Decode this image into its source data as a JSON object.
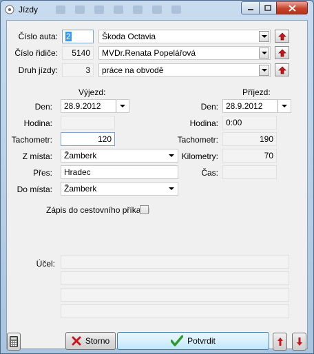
{
  "window": {
    "title": "Jízdy",
    "icon": "app-icon",
    "controls": {
      "minimize": "minimize-icon",
      "maximize": "maximize-icon",
      "close": "close-icon"
    }
  },
  "header": {
    "car_label": "Číslo auta:",
    "car_number": "2",
    "car_name": "Škoda Octavia",
    "driver_label": "Číslo řidiče:",
    "driver_number": "5140",
    "driver_name": "MVDr.Renata Popelářová",
    "trip_type_label": "Druh jízdy:",
    "trip_type_number": "3",
    "trip_type_name": "práce na obvodě"
  },
  "departure": {
    "heading": "Výjezd:",
    "date_label": "Den:",
    "date": "28.9.2012",
    "time_label": "Hodina:",
    "time": "",
    "odometer_label": "Tachometr:",
    "odometer": "120",
    "from_label": "Z místa:",
    "from": "Žamberk",
    "via_label": "Přes:",
    "via": "Hradec",
    "to_label": "Do místa:",
    "to": "Žamberk"
  },
  "arrival": {
    "heading": "Příjezd:",
    "date_label": "Den:",
    "date": "28.9.2012",
    "time_label": "Hodina:",
    "time": "0:00",
    "odometer_label": "Tachometr:",
    "odometer": "190",
    "km_label": "Kilometry:",
    "km": "70",
    "duration_label": "Čas:",
    "duration": ""
  },
  "travel_order": {
    "label": "Zápis do cestovního příkazu",
    "checked": false
  },
  "purpose": {
    "label": "Účel:",
    "lines": [
      "",
      "",
      "",
      ""
    ]
  },
  "footer": {
    "calculator_icon": "calculator-icon",
    "cancel_label": "Storno",
    "confirm_label": "Potvrdit",
    "prev_icon": "arrow-up-icon",
    "next_icon": "arrow-down-icon"
  },
  "colors": {
    "accent_red": "#c8161d",
    "confirm_green": "#2f9a2f",
    "focus_border": "#7da2ce"
  }
}
